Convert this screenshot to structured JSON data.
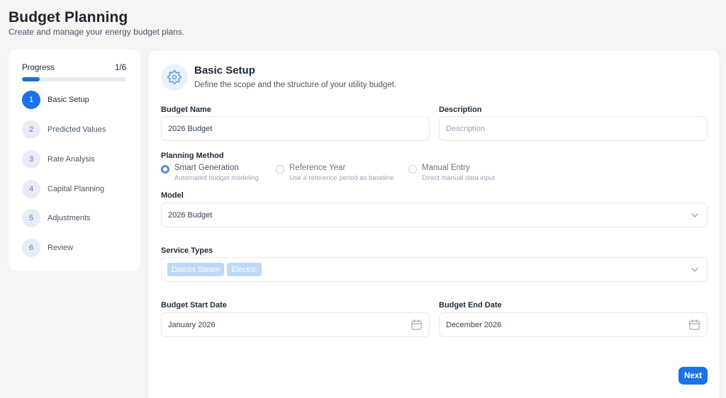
{
  "page": {
    "title": "Budget Planning",
    "subtitle": "Create and manage your energy budget plans."
  },
  "sidebar": {
    "progress_label": "Progress",
    "progress_count": "1/6",
    "progress_fraction": 0.1667,
    "steps": [
      {
        "num": "1",
        "label": "Basic Setup",
        "active": true
      },
      {
        "num": "2",
        "label": "Predicted Values",
        "active": false
      },
      {
        "num": "3",
        "label": "Rate Analysis",
        "active": false
      },
      {
        "num": "4",
        "label": "Capital Planning",
        "active": false
      },
      {
        "num": "5",
        "label": "Adjustments",
        "active": false
      },
      {
        "num": "6",
        "label": "Review",
        "active": false
      }
    ]
  },
  "section": {
    "icon": "gear-icon",
    "title": "Basic Setup",
    "description": "Define the scope and the structure of your utility budget."
  },
  "form": {
    "budget_name": {
      "label": "Budget Name",
      "value": "2026 Budget"
    },
    "description": {
      "label": "Description",
      "value": "",
      "placeholder": "Description"
    },
    "planning_method": {
      "label": "Planning Method",
      "options": [
        {
          "title": "Smart Generation",
          "subtitle": "Automated budget modeling",
          "selected": true
        },
        {
          "title": "Reference Year",
          "subtitle": "Use a reference period as baseline",
          "selected": false
        },
        {
          "title": "Manual Entry",
          "subtitle": "Direct manual data input",
          "selected": false
        }
      ]
    },
    "model": {
      "label": "Model",
      "value": "2026 Budget"
    },
    "service_types": {
      "label": "Service Types",
      "tags": [
        "District Steam",
        "Electric"
      ]
    },
    "start_date": {
      "label": "Budget Start Date",
      "value": "January 2026"
    },
    "end_date": {
      "label": "Budget End Date",
      "value": "December 2026"
    }
  },
  "actions": {
    "next_label": "Next"
  },
  "colors": {
    "accent": "#1a73e8",
    "tag_bg": "#bcd9f7",
    "page_bg": "#f5f5f5"
  }
}
